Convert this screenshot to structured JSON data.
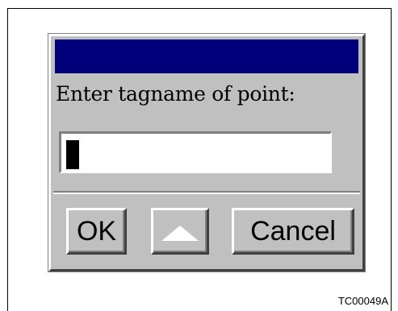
{
  "dialog": {
    "title": "",
    "prompt": "Enter tagname of point:",
    "input": {
      "value": ""
    },
    "buttons": {
      "ok_label": "OK",
      "up_icon": "up-arrow-icon",
      "cancel_label": "Cancel"
    }
  },
  "figure": {
    "code": "TC00049A"
  },
  "colors": {
    "title_bar": "#00007b",
    "dialog_face": "#c0c0c0",
    "arrow": "#ffffff"
  }
}
